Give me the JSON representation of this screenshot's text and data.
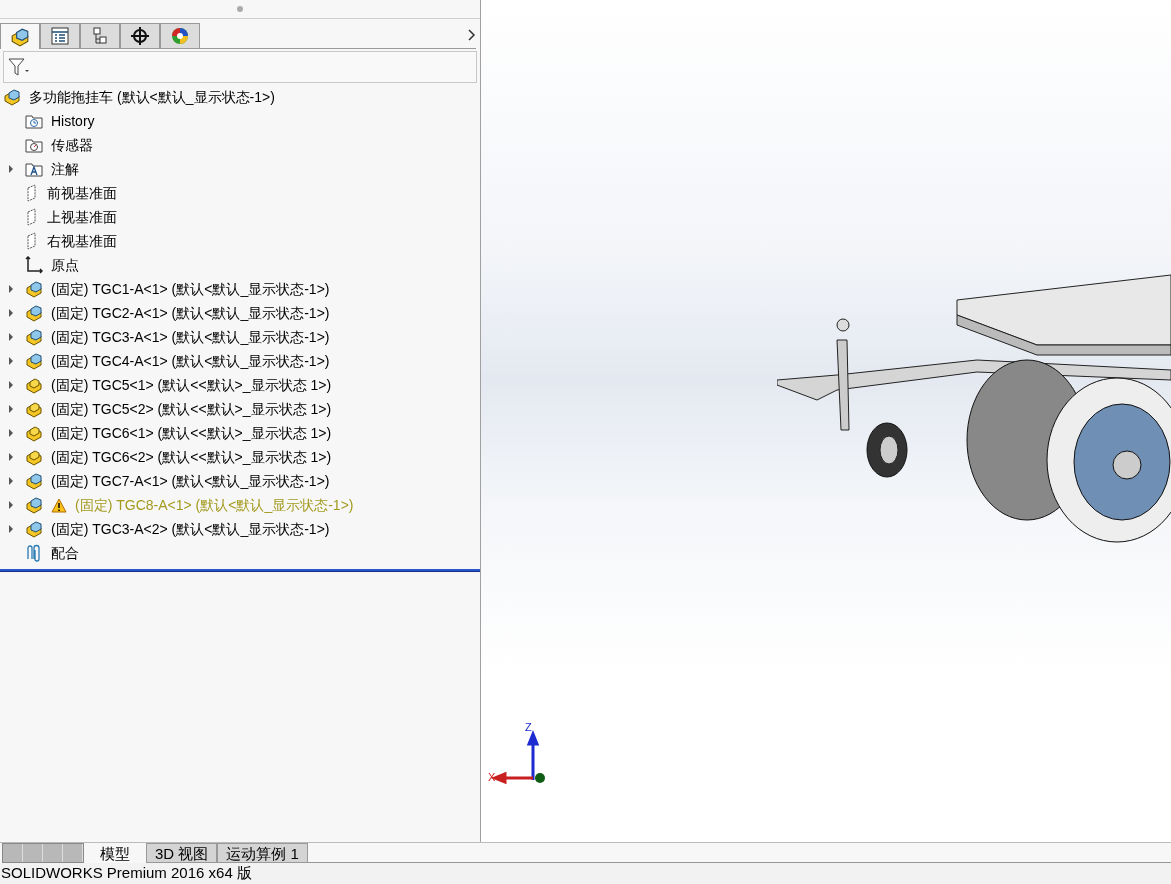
{
  "panel_tabs": [
    {
      "selected": true
    },
    {
      "selected": false
    },
    {
      "selected": false
    },
    {
      "selected": false
    },
    {
      "selected": false
    }
  ],
  "tree": {
    "label": "多功能拖挂车  (默认<默认_显示状态-1>)",
    "children": [
      {
        "kind": "history",
        "label": "History"
      },
      {
        "kind": "sensor",
        "label": "传感器"
      },
      {
        "kind": "annotation",
        "label": "注解",
        "expanded": false
      },
      {
        "kind": "plane",
        "label": "前视基准面"
      },
      {
        "kind": "plane",
        "label": "上视基准面"
      },
      {
        "kind": "plane",
        "label": "右视基准面"
      },
      {
        "kind": "origin",
        "label": "原点"
      },
      {
        "kind": "assembly",
        "label": "(固定) TGC1-A<1> (默认<默认_显示状态-1>)",
        "expanded": false,
        "warning": false
      },
      {
        "kind": "assembly",
        "label": "(固定) TGC2-A<1> (默认<默认_显示状态-1>)",
        "expanded": false,
        "warning": false
      },
      {
        "kind": "assembly",
        "label": "(固定) TGC3-A<1> (默认<默认_显示状态-1>)",
        "expanded": false,
        "warning": false
      },
      {
        "kind": "assembly",
        "label": "(固定) TGC4-A<1> (默认<默认_显示状态-1>)",
        "expanded": false,
        "warning": false
      },
      {
        "kind": "part",
        "label": "(固定) TGC5<1> (默认<<默认>_显示状态 1>)",
        "expanded": false,
        "warning": false
      },
      {
        "kind": "part",
        "label": "(固定) TGC5<2> (默认<<默认>_显示状态 1>)",
        "expanded": false,
        "warning": false
      },
      {
        "kind": "part",
        "label": "(固定) TGC6<1> (默认<<默认>_显示状态 1>)",
        "expanded": false,
        "warning": false
      },
      {
        "kind": "part",
        "label": "(固定) TGC6<2> (默认<<默认>_显示状态 1>)",
        "expanded": false,
        "warning": false
      },
      {
        "kind": "assembly",
        "label": "(固定) TGC7-A<1> (默认<默认_显示状态-1>)",
        "expanded": false,
        "warning": false
      },
      {
        "kind": "assembly",
        "label": "(固定) TGC8-A<1> (默认<默认_显示状态-1>)",
        "expanded": false,
        "warning": true
      },
      {
        "kind": "assembly",
        "label": "(固定) TGC3-A<2> (默认<默认_显示状态-1>)",
        "expanded": false,
        "warning": false
      },
      {
        "kind": "mates",
        "label": "配合"
      }
    ]
  },
  "triad": {
    "x_label": "X",
    "z_label": "Z"
  },
  "bottom_tabs": [
    {
      "label": "模型",
      "selected": true
    },
    {
      "label": "3D 视图",
      "selected": false
    },
    {
      "label": "运动算例 1",
      "selected": false
    }
  ],
  "status_bar": "SOLIDWORKS Premium 2016 x64 版"
}
